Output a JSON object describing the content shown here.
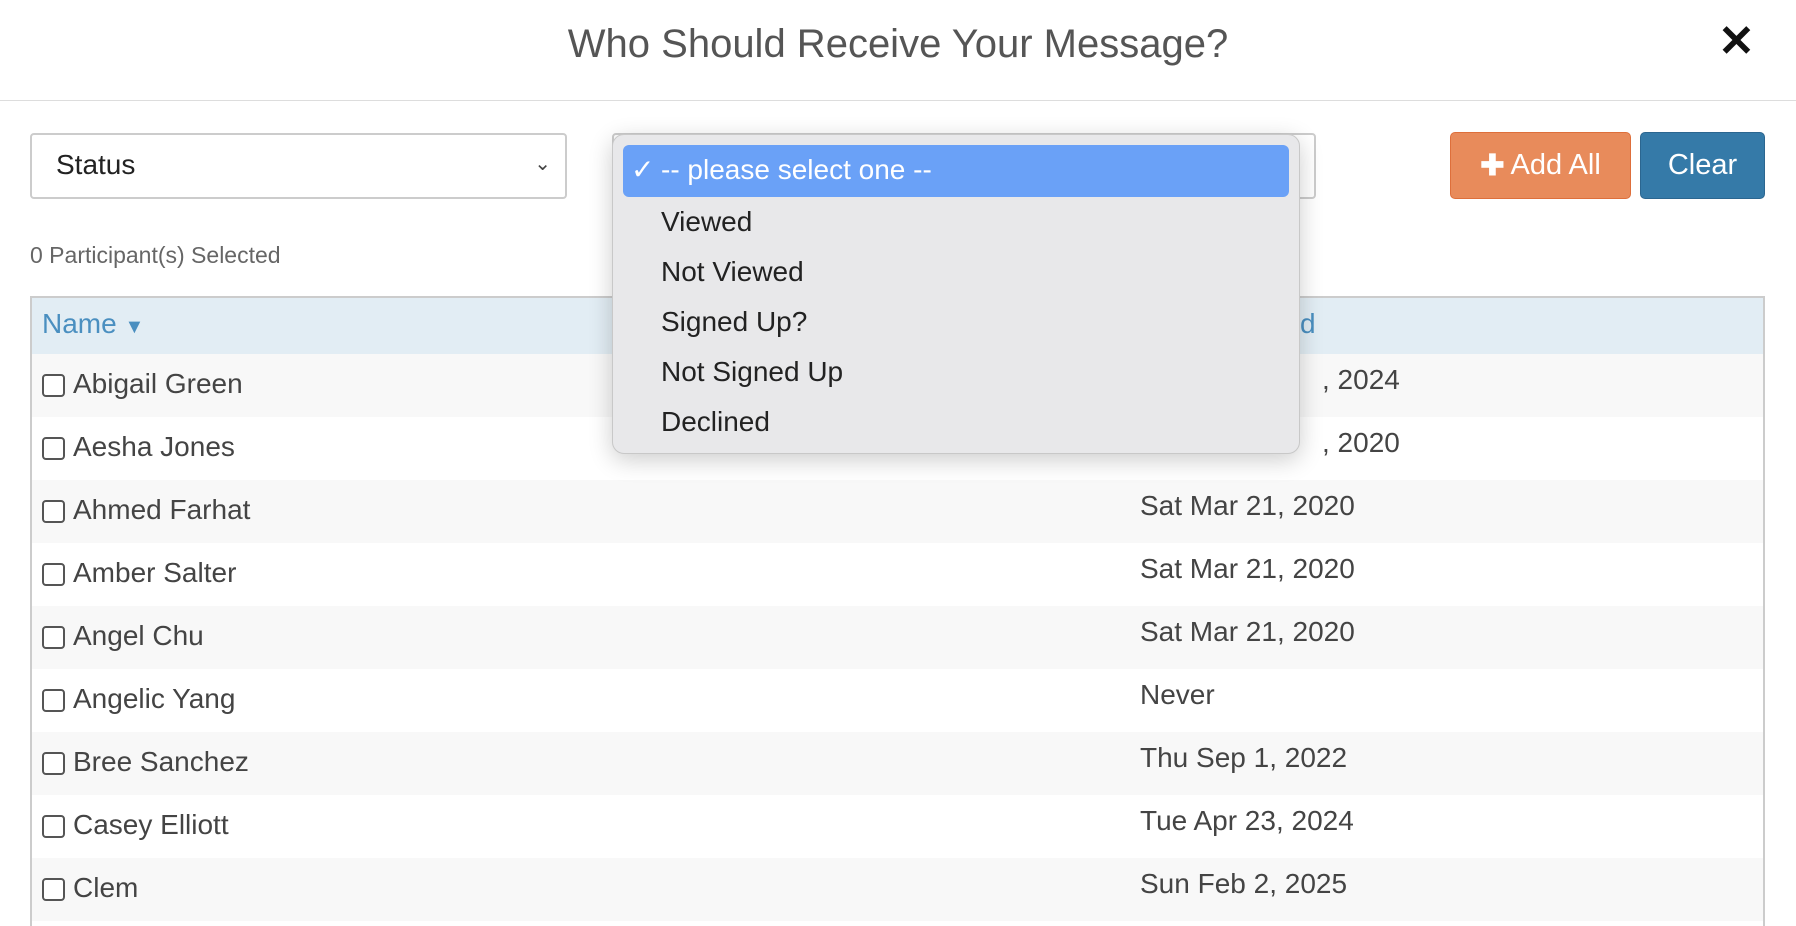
{
  "header": {
    "title": "Who Should Receive Your Message?",
    "close_icon": "close-icon"
  },
  "filters": {
    "field_select": "Status",
    "value_select_options": [
      "-- please select one --",
      "Viewed",
      "Not Viewed",
      "Signed Up?",
      "Not Signed Up",
      "Declined"
    ],
    "selected": "-- please select one --"
  },
  "buttons": {
    "add_all": "Add All",
    "add_all_icon": "plus-icon",
    "clear": "Clear"
  },
  "colors": {
    "add_all": "#e88b5b",
    "clear": "#357aa8",
    "highlight": "#6aa1f7",
    "header_link": "#4a8fc0"
  },
  "selected_count": "0 Participant(s) Selected",
  "table": {
    "columns": [
      {
        "label": "Name",
        "sort_icon": "chevron-down-icon"
      },
      {
        "label": "d"
      }
    ],
    "rows": [
      {
        "name": "Abigail Green",
        "date": ", 2024"
      },
      {
        "name": "Aesha Jones",
        "date": ", 2020"
      },
      {
        "name": "Ahmed Farhat",
        "date": "Sat Mar 21, 2020"
      },
      {
        "name": "Amber Salter",
        "date": "Sat Mar 21, 2020"
      },
      {
        "name": "Angel Chu",
        "date": "Sat Mar 21, 2020"
      },
      {
        "name": "Angelic Yang",
        "date": "Never"
      },
      {
        "name": "Bree Sanchez",
        "date": "Thu Sep 1, 2022"
      },
      {
        "name": "Casey Elliott",
        "date": "Tue Apr 23, 2024"
      },
      {
        "name": "Clem",
        "date": "Sun Feb 2, 2025"
      },
      {
        "name": "",
        "date": ""
      }
    ]
  }
}
